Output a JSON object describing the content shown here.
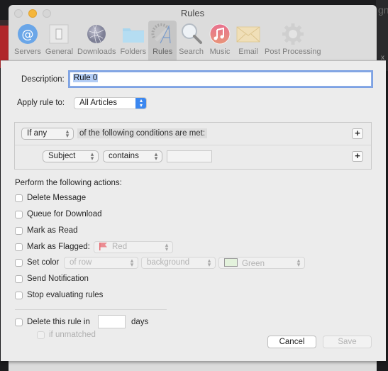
{
  "window": {
    "title": "Rules",
    "toolbar": [
      {
        "label": "Servers",
        "icon": "at-sign-icon",
        "active": false
      },
      {
        "label": "General",
        "icon": "switch-icon",
        "active": false
      },
      {
        "label": "Downloads",
        "icon": "globe-icon",
        "active": false
      },
      {
        "label": "Folders",
        "icon": "folder-icon",
        "active": false
      },
      {
        "label": "Rules",
        "icon": "rules-icon",
        "active": true
      },
      {
        "label": "Search",
        "icon": "magnifier-icon",
        "active": false
      },
      {
        "label": "Music",
        "icon": "music-note-icon",
        "active": false
      },
      {
        "label": "Email",
        "icon": "envelope-icon",
        "active": false
      },
      {
        "label": "Post Processing",
        "icon": "gear-icon",
        "active": false
      }
    ]
  },
  "sheet": {
    "description": {
      "label": "Description:",
      "value": "Rule 0"
    },
    "apply_rule": {
      "label": "Apply rule to:",
      "value": "All Articles"
    },
    "conditions": {
      "match_mode": "If any",
      "match_text": "of the following conditions are met:",
      "rows": [
        {
          "field": "Subject",
          "operator": "contains",
          "value": ""
        }
      ],
      "add_symbol": "+"
    },
    "actions_heading": "Perform the following actions:",
    "actions": {
      "delete_message": {
        "label": "Delete Message",
        "checked": false
      },
      "queue_download": {
        "label": "Queue for Download",
        "checked": false
      },
      "mark_read": {
        "label": "Mark as Read",
        "checked": false
      },
      "mark_flagged": {
        "label": "Mark as Flagged:",
        "checked": false,
        "flag_color": "Red",
        "flag_hex": "#e66a72"
      },
      "set_color": {
        "label": "Set color",
        "checked": false,
        "scope": "of row",
        "target": "background",
        "color": "Green",
        "color_hex": "#e3f2dc"
      },
      "send_notification": {
        "label": "Send Notification",
        "checked": false
      },
      "stop_evaluating": {
        "label": "Stop evaluating rules",
        "checked": false
      }
    },
    "expiry": {
      "label": "Delete this rule in",
      "days_value": "",
      "days_label": "days",
      "if_unmatched": "if unmatched"
    },
    "buttons": {
      "cancel": "Cancel",
      "save": "Save"
    }
  },
  "background": {
    "right_text": "gn",
    "right_close": "x"
  }
}
